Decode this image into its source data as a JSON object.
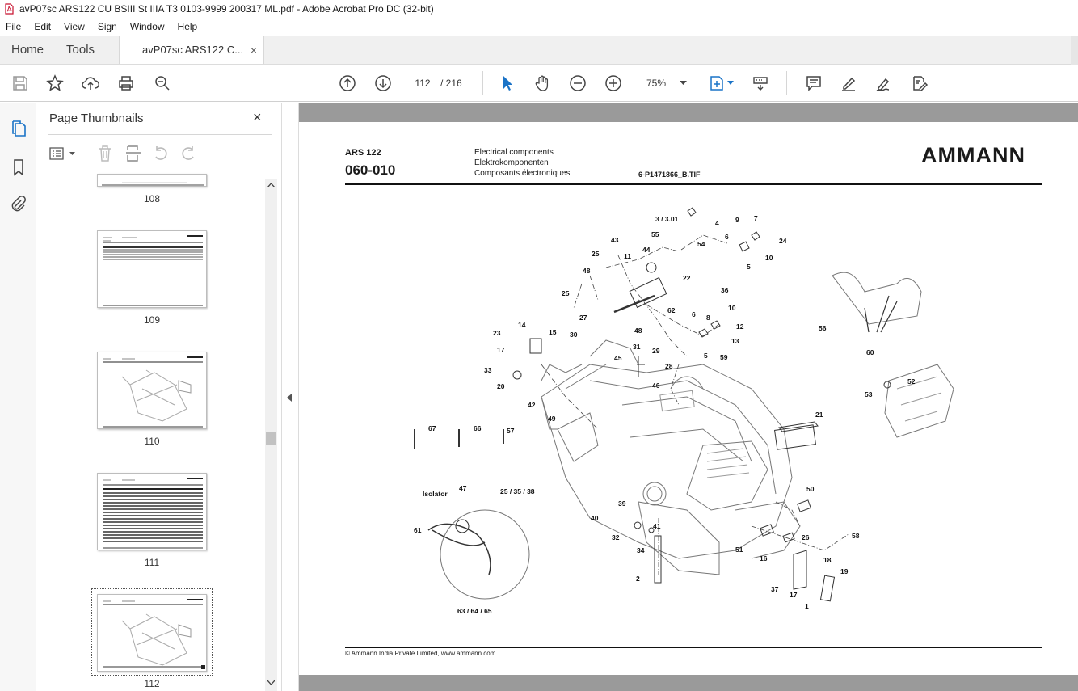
{
  "window": {
    "title": "avP07sc ARS122 CU BSIII St IIIA T3 0103-9999 200317 ML.pdf - Adobe Acrobat Pro DC (32-bit)"
  },
  "menu": {
    "items": [
      "File",
      "Edit",
      "View",
      "Sign",
      "Window",
      "Help"
    ]
  },
  "tabs": {
    "home": "Home",
    "tools": "Tools",
    "document": "avP07sc ARS122 C...",
    "close": "×"
  },
  "toolbar": {
    "current_page": "112",
    "total_pages": "/ 216",
    "zoom": "75%",
    "icons": [
      "save-icon",
      "bookmark-star-icon",
      "upload-icon",
      "print-icon",
      "find-zoom-icon",
      "page-up-icon",
      "page-down-icon",
      "select-cursor-icon",
      "hand-icon",
      "zoom-out-icon",
      "zoom-in-icon",
      "fit-page-icon",
      "keyboard-icon",
      "comment-icon",
      "highlight-icon",
      "sign-icon",
      "fill-sign-icon"
    ]
  },
  "sidebar": {
    "title": "Page Thumbnails",
    "close": "×",
    "thumbnails": [
      {
        "label": "108"
      },
      {
        "label": "109"
      },
      {
        "label": "110"
      },
      {
        "label": "111"
      },
      {
        "label": "112",
        "selected": true
      }
    ]
  },
  "document": {
    "model": "ARS 122",
    "code": "060-010",
    "desc_en": "Electrical components",
    "desc_de": "Elektrokomponenten",
    "desc_fr": "Composants électroniques",
    "file_ref": "6-P1471866_B.TIF",
    "brand": "AMMANN",
    "footer": "© Ammann India Private Limited, www.ammann.com",
    "callouts": [
      "3 / 3.01",
      "4",
      "9",
      "7",
      "55",
      "54",
      "6",
      "24",
      "10",
      "5",
      "43",
      "25",
      "44",
      "11",
      "22",
      "48",
      "25",
      "36",
      "62",
      "27",
      "48",
      "6",
      "8",
      "10",
      "12",
      "13",
      "5",
      "59",
      "14",
      "23",
      "15",
      "30",
      "31",
      "17",
      "45",
      "29",
      "28",
      "33",
      "20",
      "46",
      "42",
      "49",
      "21",
      "67",
      "66",
      "57",
      "56",
      "60",
      "52",
      "53",
      "Isolator",
      "47",
      "25 / 35 / 38",
      "61",
      "63 / 64 / 65",
      "39",
      "40",
      "32",
      "41",
      "34",
      "2",
      "50",
      "26",
      "58",
      "51",
      "16",
      "18",
      "19",
      "37",
      "17",
      "1"
    ]
  }
}
